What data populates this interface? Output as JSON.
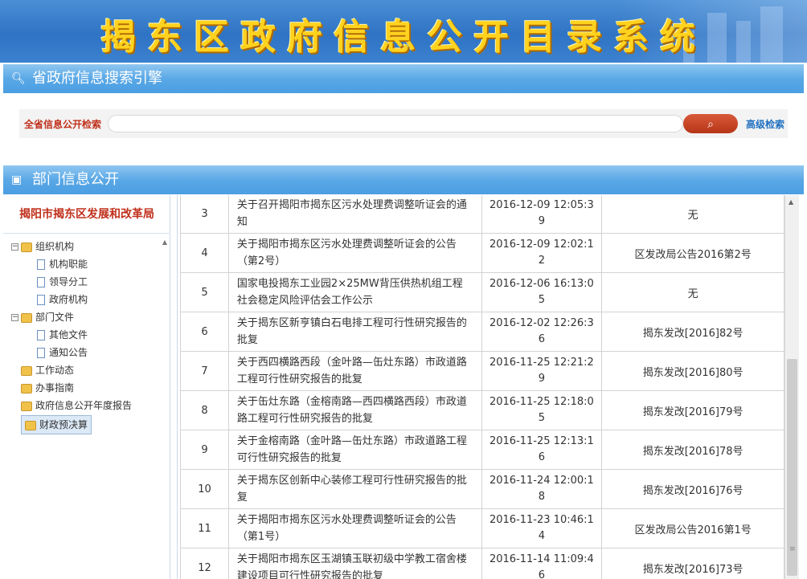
{
  "banner": {
    "title": "揭东区政府信息公开目录系统"
  },
  "search_section": {
    "title": "省政府信息搜索引擎",
    "label": "全省信息公开检索",
    "placeholder": "",
    "button_icon": "search-icon",
    "advanced": "高级检索"
  },
  "dept_section": {
    "title": "部门信息公开"
  },
  "left": {
    "dept_name": "揭阳市揭东区发展和改革局",
    "tree": [
      {
        "label": "组织机构",
        "kind": "folder",
        "expanded": "⊟"
      },
      {
        "label": "机构职能",
        "kind": "doc"
      },
      {
        "label": "领导分工",
        "kind": "doc"
      },
      {
        "label": "政府机构",
        "kind": "doc"
      },
      {
        "label": "部门文件",
        "kind": "folder",
        "expanded": "⊟"
      },
      {
        "label": "其他文件",
        "kind": "doc"
      },
      {
        "label": "通知公告",
        "kind": "doc"
      },
      {
        "label": "工作动态",
        "kind": "folder"
      },
      {
        "label": "办事指南",
        "kind": "folder"
      },
      {
        "label": "政府信息公开年度报告",
        "kind": "folder"
      },
      {
        "label": "财政预决算",
        "kind": "folder",
        "selected": true
      }
    ]
  },
  "rows": [
    {
      "num": "3",
      "title": "关于召开揭阳市揭东区污水处理费调整听证会的通知",
      "date": "2016-12-09 12:05:39",
      "doc_no": "无"
    },
    {
      "num": "4",
      "title": "关于揭阳市揭东区污水处理费调整听证会的公告（第2号）",
      "date": "2016-12-09 12:02:12",
      "doc_no": "区发改局公告2016第2号"
    },
    {
      "num": "5",
      "title": "国家电投揭东工业园2×25MW背压供热机组工程社会稳定风险评估会工作公示",
      "date": "2016-12-06 16:13:05",
      "doc_no": "无"
    },
    {
      "num": "6",
      "title": "关于揭东区新亨镇白石电排工程可行性研究报告的批复",
      "date": "2016-12-02 12:26:36",
      "doc_no": "揭东发改[2016]82号"
    },
    {
      "num": "7",
      "title": "关于西四横路西段（金叶路—缶灶东路）市政道路工程可行性研究报告的批复",
      "date": "2016-11-25 12:21:29",
      "doc_no": "揭东发改[2016]80号"
    },
    {
      "num": "8",
      "title": "关于缶灶东路（金榕南路—西四横路西段）市政道路工程可行性研究报告的批复",
      "date": "2016-11-25 12:18:05",
      "doc_no": "揭东发改[2016]79号"
    },
    {
      "num": "9",
      "title": "关于金榕南路（金叶路—缶灶东路）市政道路工程可行性研究报告的批复",
      "date": "2016-11-25 12:13:16",
      "doc_no": "揭东发改[2016]78号"
    },
    {
      "num": "10",
      "title": "关于揭东区创新中心装修工程可行性研究报告的批复",
      "date": "2016-11-24 12:00:18",
      "doc_no": "揭东发改[2016]76号"
    },
    {
      "num": "11",
      "title": "关于揭阳市揭东区污水处理费调整听证会的公告（第1号）",
      "date": "2016-11-23 10:46:14",
      "doc_no": "区发改局公告2016第1号"
    },
    {
      "num": "12",
      "title": "关于揭阳市揭东区玉湖镇玉联初级中学教工宿舍楼建设项目可行性研究报告的批复",
      "date": "2016-11-14 11:09:46",
      "doc_no": "揭东发改[2016]73号"
    }
  ]
}
